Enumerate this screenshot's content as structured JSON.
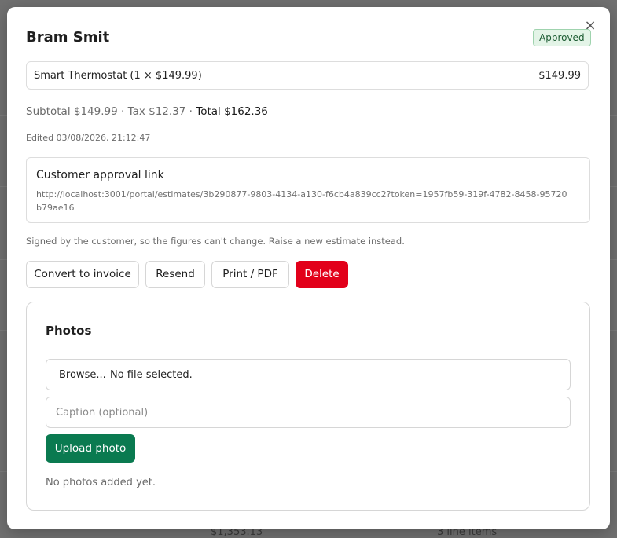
{
  "background": {
    "amount_text": "$1,353.13",
    "items_text": "3 line items"
  },
  "modal": {
    "close_glyph": "×",
    "title": "Bram Smit",
    "status_badge": "Approved",
    "line_item": {
      "description": "Smart Thermostat (1 × $149.99)",
      "amount": "$149.99"
    },
    "totals": {
      "subtotal": "Subtotal $149.99",
      "separator": " · ",
      "tax": "Tax $12.37",
      "total": "Total $162.36"
    },
    "edited": "Edited 03/08/2026, 21:12:47",
    "approval": {
      "label": "Customer approval link",
      "url": "http://localhost:3001/portal/estimates/3b290877-9803-4134-a130-f6cb4a839cc2?token=1957fb59-319f-4782-8458-95720b79ae16"
    },
    "notice": "Signed by the customer, so the figures can't change. Raise a new estimate instead.",
    "actions": {
      "convert": "Convert to invoice",
      "resend": "Resend",
      "print": "Print / PDF",
      "delete": "Delete"
    },
    "photos": {
      "heading": "Photos",
      "browse_label": "Browse...",
      "file_status": "No file selected.",
      "caption_placeholder": "Caption (optional)",
      "upload_label": "Upload photo",
      "empty_note": "No photos added yet."
    }
  },
  "colors": {
    "danger": "#e2001a",
    "primary": "#0a7a50",
    "badge_bg": "#e3f4e7"
  }
}
